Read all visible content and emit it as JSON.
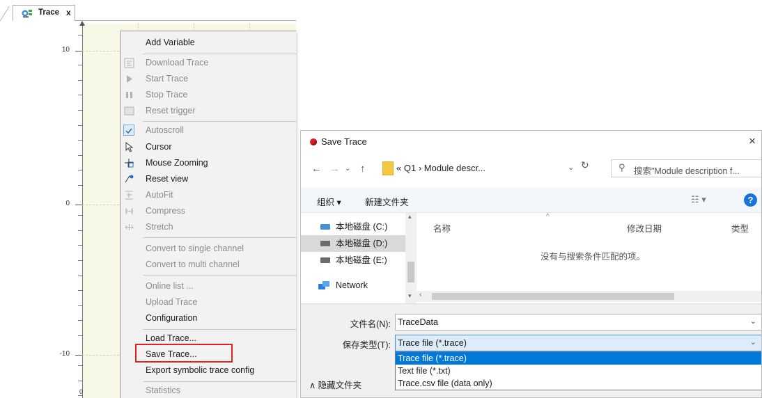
{
  "trace_tab": {
    "label": "Trace",
    "close": "x"
  },
  "chart": {
    "y_tick_labels": [
      "10",
      "0",
      "-10"
    ],
    "x_tick_label": "0"
  },
  "context_menu": {
    "items": [
      {
        "label": "Add Variable"
      },
      {
        "label": "Download Trace"
      },
      {
        "label": "Start Trace"
      },
      {
        "label": "Stop Trace"
      },
      {
        "label": "Reset trigger"
      },
      {
        "label": "Autoscroll"
      },
      {
        "label": "Cursor"
      },
      {
        "label": "Mouse Zooming"
      },
      {
        "label": "Reset view"
      },
      {
        "label": "AutoFit"
      },
      {
        "label": "Compress"
      },
      {
        "label": "Stretch"
      },
      {
        "label": "Convert to single channel"
      },
      {
        "label": "Convert to multi channel"
      },
      {
        "label": "Online list ..."
      },
      {
        "label": "Upload Trace"
      },
      {
        "label": "Configuration"
      },
      {
        "label": "Load Trace..."
      },
      {
        "label": "Save Trace..."
      },
      {
        "label": "Export symbolic trace config"
      },
      {
        "label": "Statistics"
      }
    ]
  },
  "dialog": {
    "title": "Save Trace",
    "close": "×",
    "address": {
      "prefix": "«",
      "segments": [
        "Q1",
        "Module descr..."
      ]
    },
    "search_placeholder": "搜索\"Module description f...",
    "toolbar": {
      "organize": "组织 ▾",
      "new_folder": "新建文件夹"
    },
    "nav_items": [
      {
        "label": "本地磁盘 (C:)"
      },
      {
        "label": "本地磁盘 (D:)"
      },
      {
        "label": "本地磁盘 (E:)"
      },
      {
        "label": "Network"
      }
    ],
    "columns": {
      "name": "名称",
      "modified": "修改日期",
      "type": "类型"
    },
    "empty_message": "没有与搜索条件匹配的项。",
    "file_name_label": "文件名(N):",
    "file_name_value": "TraceData",
    "save_type_label": "保存类型(T):",
    "save_type_value": "Trace file (*.trace)",
    "save_type_options": [
      "Trace file (*.trace)",
      "Text file (*.txt)",
      "Trace.csv file (data only)"
    ],
    "hide_folders": "隐藏文件夹"
  }
}
